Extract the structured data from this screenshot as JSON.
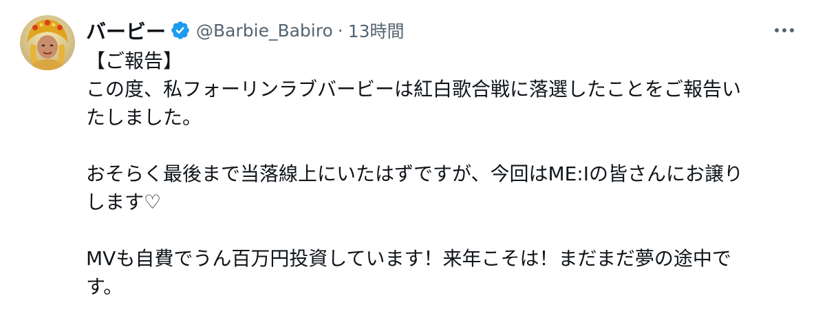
{
  "author": {
    "display_name": "バービー",
    "handle": "@Barbie_Babiro",
    "separator": "·",
    "time": "13時間",
    "verified": true
  },
  "icons": {
    "verified": "verified-badge-icon",
    "more": "more-options-icon"
  },
  "colors": {
    "verified_blue": "#1d9bf0",
    "text_primary": "#0f1419",
    "text_secondary": "#536471"
  },
  "tweet": {
    "lines": [
      "【ご報告】",
      "この度、私フォーリンラブバービーは紅白歌合戦に落選したことをご報告い",
      "たしました。",
      "",
      "おそらく最後まで当落線上にいたはずですが、今回はME:Iの皆さんにお譲り",
      "します♡",
      "",
      "MVも自費でうん百万円投資しています！来年こそは！まだまだ夢の途中で",
      "す。"
    ]
  }
}
